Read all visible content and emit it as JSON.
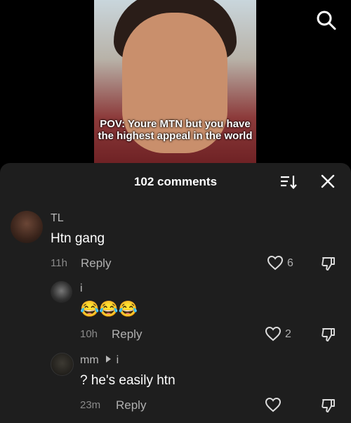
{
  "video": {
    "caption": "POV: Youre MTN but you have the highest appeal in the world"
  },
  "icons": {
    "search": "search-icon",
    "sort": "sort-icon",
    "close": "close-icon",
    "like": "heart-icon",
    "dislike": "thumbs-down-icon"
  },
  "comments_panel": {
    "title": "102 comments",
    "reply_label": "Reply",
    "comments": [
      {
        "username": "TL",
        "text": "Htn gang",
        "time": "11h",
        "likes": "6"
      },
      {
        "username": "i",
        "text": "😂😂😂",
        "time": "10h",
        "likes": "2"
      },
      {
        "username": "mm",
        "reply_to": "i",
        "text": "? he's easily htn",
        "time": "23m",
        "likes": ""
      }
    ]
  }
}
